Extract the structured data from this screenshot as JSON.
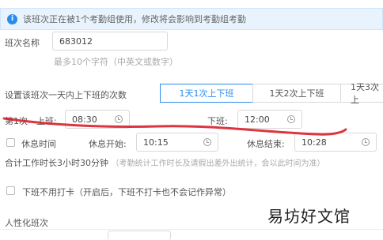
{
  "notice": {
    "text": "该班次正在被1个考勤组使用，修改将会影响到考勤组考勤"
  },
  "shift_name": {
    "label": "班次名称",
    "value": "683012",
    "hint": "最多10个字符（中英文或数字）"
  },
  "times_per_day": {
    "label": "设置该班次一天内上下班的次数",
    "tabs": [
      "1天1次上下班",
      "1天2次上下班",
      "1天3次上"
    ]
  },
  "first_shift": {
    "label": "第1次",
    "on_label": "上班:",
    "on_value": "08:30",
    "off_label": "下班:",
    "off_value": "12:00"
  },
  "rest": {
    "label": "休息时间",
    "start_label": "休息开始:",
    "start_value": "10:15",
    "end_label": "休息结束:",
    "end_value": "10:28"
  },
  "total_work": {
    "text": "合计工作时长3小时30分钟",
    "hint": "（考勤统计工作时长及请假出差外出统计，会以此时间为准）"
  },
  "no_clock_out": {
    "text": "下班不用打卡（开启后，下班不打卡也不会记作异常）"
  },
  "humanized": {
    "label": "人性化班次"
  },
  "watermark": {
    "text": "易坊好文馆"
  },
  "colors": {
    "accent": "#2b8cf0",
    "annotation": "#d8202a"
  }
}
